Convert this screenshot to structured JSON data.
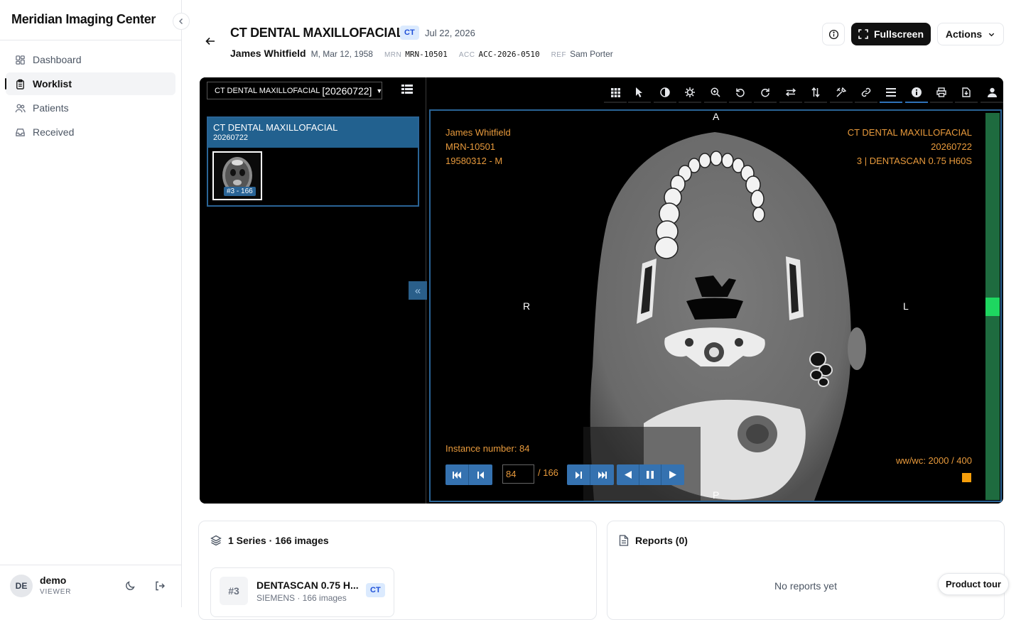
{
  "app": {
    "title": "Meridian Imaging Center"
  },
  "sidebar": {
    "items": [
      {
        "label": "Dashboard",
        "icon": "dashboard-icon",
        "active": false
      },
      {
        "label": "Worklist",
        "icon": "clipboard-icon",
        "active": true
      },
      {
        "label": "Patients",
        "icon": "users-icon",
        "active": false
      },
      {
        "label": "Received",
        "icon": "inbox-icon",
        "active": false
      }
    ],
    "user": {
      "initials": "DE",
      "name": "demo",
      "role": "VIEWER"
    }
  },
  "header": {
    "title": "CT DENTAL MAXILLOFACIAL",
    "modality": "CT",
    "date": "Jul 22, 2026",
    "patient_name": "James Whitfield",
    "patient_demo": "M, Mar 12, 1958",
    "mrn_key": "MRN",
    "mrn": "MRN-10501",
    "acc_key": "ACC",
    "acc": "ACC-2026-0510",
    "ref_key": "REF",
    "ref": "Sam Porter",
    "fullscreen_label": "Fullscreen",
    "actions_label": "Actions"
  },
  "viewer": {
    "series_select": {
      "prefix": "CT DENTAL MAXILLOFACIAL",
      "date": "[20260722]"
    },
    "study_card": {
      "title": "CT DENTAL MAXILLOFACIAL",
      "date": "20260722",
      "thumb_label": "#3 - 166"
    },
    "toolbar": [
      "layout-grid-icon",
      "pointer-icon",
      "contrast-icon",
      "settings-icon",
      "zoom-icon",
      "rotate-left-icon",
      "rotate-right-icon",
      "flip-horizontal-icon",
      "flip-vertical-icon",
      "tools-icon",
      "link-icon",
      "menu-icon",
      "info-icon",
      "print-icon",
      "download-icon",
      "user-icon"
    ],
    "overlay": {
      "top_left": [
        "James Whitfield",
        "MRN-10501",
        "19580312 - M"
      ],
      "top_right": [
        "CT DENTAL MAXILLOFACIAL",
        "20260722",
        "3 | DENTASCAN 0.75 H60S"
      ],
      "instance": "Instance number: 84",
      "wwwc": "ww/wc: 2000 / 400",
      "orient_top": "A",
      "orient_bottom": "P",
      "orient_left": "R",
      "orient_right": "L"
    },
    "cine": {
      "frame": "84",
      "total": "/ 166"
    },
    "accent": "#2a6496",
    "overlay_color": "#e89a3c"
  },
  "series_card": {
    "title": "1 Series · 166 images",
    "series": {
      "number": "#3",
      "name": "DENTASCAN 0.75 H...",
      "sub": "SIEMENS · 166 images",
      "modality": "CT"
    }
  },
  "reports_card": {
    "title": "Reports (0)",
    "empty": "No reports yet"
  },
  "tour_label": "Product tour"
}
